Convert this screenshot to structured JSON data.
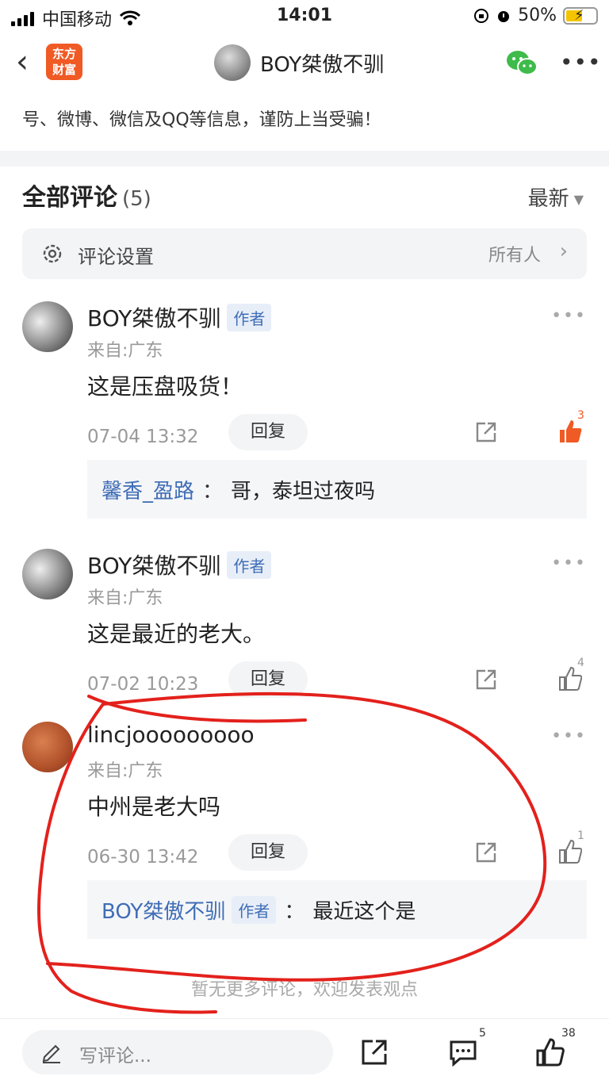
{
  "status_bar": {
    "carrier": "中国移动",
    "time": "14:01",
    "battery": "50%"
  },
  "nav": {
    "logo_line1": "东方",
    "logo_line2": "财富",
    "title": "BOY桀傲不驯"
  },
  "notice_text": "号、微博、微信及QQ等信息，谨防上当受骗！",
  "comments_header": {
    "title": "全部评论",
    "count": "(5)",
    "sort": "最新"
  },
  "settings": {
    "label": "评论设置",
    "value": "所有人"
  },
  "comments": [
    {
      "name": "BOY桀傲不驯",
      "badge": "作者",
      "location": "来自:广东",
      "text": "这是压盘吸货！",
      "time": "07-04 13:32",
      "reply_label": "回复",
      "likes": "3",
      "sub_reply": {
        "name": "馨香_盈路",
        "sep": "：",
        "text": "哥，泰坦过夜吗"
      }
    },
    {
      "name": "BOY桀傲不驯",
      "badge": "作者",
      "location": "来自:广东",
      "text": "这是最近的老大。",
      "time": "07-02 10:23",
      "reply_label": "回复",
      "likes": "4"
    },
    {
      "name": "lincjooooooooo",
      "location": "来自:广东",
      "text": "中州是老大吗",
      "time": "06-30 13:42",
      "reply_label": "回复",
      "likes": "1",
      "sub_reply": {
        "name": "BOY桀傲不驯",
        "badge": "作者",
        "sep": "：",
        "text": "最近这个是"
      }
    }
  ],
  "end_text": "暂无更多评论，欢迎发表观点",
  "bottom_bar": {
    "placeholder": "写评论...",
    "comment_count": "5",
    "like_count": "38"
  },
  "colors": {
    "accent": "#f05a24",
    "link": "#3f6db6",
    "annotation": "#e3211c"
  }
}
